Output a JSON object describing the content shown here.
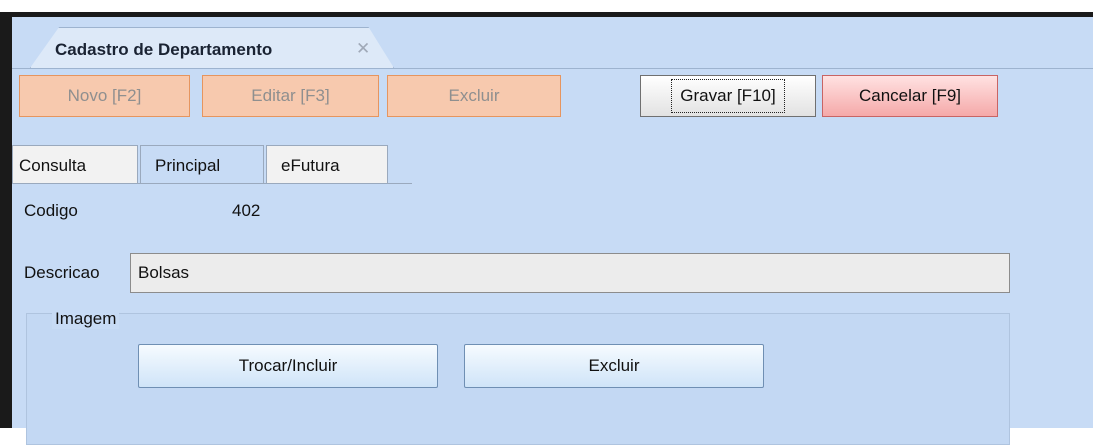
{
  "document_tab": {
    "title": "Cadastro de Departamento",
    "close_glyph": "✕"
  },
  "toolbar": {
    "novo_label": "Novo [F2]",
    "editar_label": "Editar [F3]",
    "excluir_label": "Excluir",
    "gravar_label": "Gravar [F10]",
    "cancelar_label": "Cancelar [F9]"
  },
  "tabs": [
    {
      "label": "Consulta",
      "active": false
    },
    {
      "label": "Principal",
      "active": true
    },
    {
      "label": "eFutura",
      "active": false
    }
  ],
  "form": {
    "codigo_label": "Codigo",
    "codigo_value": "402",
    "descricao_label": "Descricao",
    "descricao_value": "Bolsas"
  },
  "imagem_group": {
    "label": "Imagem",
    "trocar_label": "Trocar/Incluir",
    "excluir_label": "Excluir"
  },
  "colors": {
    "panel_bg": "#c7dbf5",
    "disabled_button_bg": "#f7c9ae",
    "cancel_button_bg": "#f5a9a9"
  }
}
